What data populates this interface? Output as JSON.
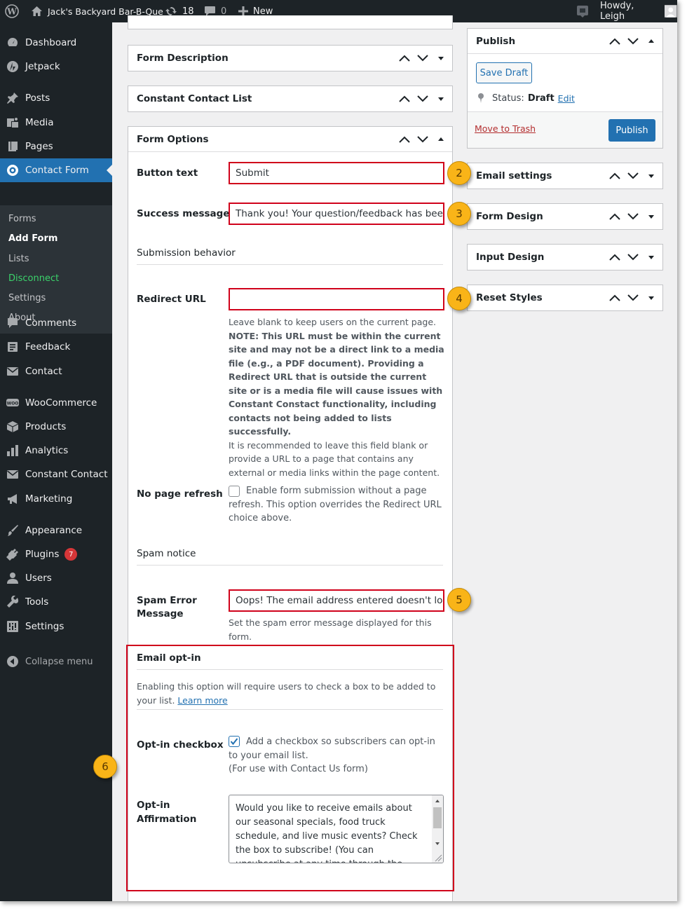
{
  "admin_bar": {
    "site_name": "Jack's Backyard Bar-B-Que",
    "updates_count": "18",
    "comments_count": "0",
    "new_label": "New",
    "howdy": "Howdy, Leigh"
  },
  "sidebar": {
    "items": [
      {
        "label": "Dashboard",
        "icon": "dashboard-icon"
      },
      {
        "label": "Jetpack",
        "icon": "jetpack-icon"
      },
      {
        "label": "Posts",
        "icon": "pin-icon"
      },
      {
        "label": "Media",
        "icon": "media-icon"
      },
      {
        "label": "Pages",
        "icon": "pages-icon"
      },
      {
        "label": "Contact Form",
        "icon": "contact-form-icon"
      },
      {
        "label": "Comments",
        "icon": "comment-icon"
      },
      {
        "label": "Feedback",
        "icon": "feedback-icon"
      },
      {
        "label": "Contact",
        "icon": "envelope-icon"
      },
      {
        "label": "WooCommerce",
        "icon": "woocommerce-icon"
      },
      {
        "label": "Products",
        "icon": "box-icon"
      },
      {
        "label": "Analytics",
        "icon": "bar-chart-icon"
      },
      {
        "label": "Constant Contact",
        "icon": "envelope-icon"
      },
      {
        "label": "Marketing",
        "icon": "megaphone-icon"
      },
      {
        "label": "Appearance",
        "icon": "brush-icon"
      },
      {
        "label": "Plugins",
        "icon": "plug-icon",
        "badge": "7"
      },
      {
        "label": "Users",
        "icon": "user-icon"
      },
      {
        "label": "Tools",
        "icon": "wrench-icon"
      },
      {
        "label": "Settings",
        "icon": "sliders-icon"
      }
    ],
    "submenu": [
      "Forms",
      "Add Form",
      "Lists",
      "Disconnect",
      "Settings",
      "About"
    ],
    "collapse": "Collapse menu"
  },
  "main": {
    "boxes": {
      "form_description": "Form Description",
      "cc_list": "Constant Contact List",
      "form_options": "Form Options"
    },
    "button_text": {
      "label": "Button text",
      "value": "Submit"
    },
    "success_message": {
      "label": "Success message",
      "value": "Thank you! Your question/feedback has been s"
    },
    "submission_behavior": "Submission behavior",
    "redirect_url": {
      "label": "Redirect URL",
      "value": "",
      "help_1": "Leave blank to keep users on the current page.",
      "help_note": "NOTE: This URL must be within the current site and may not be a direct link to a media file (e.g., a PDF document). Providing a Redirect URL that is outside the current site or is a media file will cause issues with Constant Constact functionality, including contacts not being added to lists successfully.",
      "help_2": "It is recommended to leave this field blank or provide a URL to a page that contains any external or media links within the page content."
    },
    "no_refresh": {
      "label": "No page refresh",
      "text": "Enable form submission without a page refresh. This option overrides the Redirect URL choice above."
    },
    "spam_notice": "Spam notice",
    "spam_error": {
      "label_1": "Spam Error",
      "label_2": "Message",
      "value": "Oops! The email address entered doesn't look c",
      "help": "Set the spam error message displayed for this form."
    },
    "email_optin": {
      "title": "Email opt-in",
      "desc": "Enabling this option will require users to check a box to be added to your list.",
      "learn_more": "Learn more",
      "checkbox_label": "Opt-in checkbox",
      "checkbox_text_1": "Add a checkbox so subscribers can opt-in to your email list.",
      "checkbox_text_2": "(For use with Contact Us form)",
      "affirmation_label_1": "Opt-in",
      "affirmation_label_2": "Affirmation",
      "affirmation_text": "Would you like to receive emails about our seasonal specials, food truck schedule, and live music events? Check the box to subscribe! (You can unsubscribe at any time through the \"Unsubscribe\" link in any email)"
    }
  },
  "right": {
    "publish": {
      "title": "Publish",
      "save_draft": "Save Draft",
      "status_label": "Status:",
      "status_value": "Draft",
      "edit": "Edit",
      "trash": "Move to Trash",
      "publish_btn": "Publish"
    },
    "boxes": [
      "Email settings",
      "Form Design",
      "Input Design",
      "Reset Styles"
    ]
  },
  "callouts": [
    "2",
    "3",
    "4",
    "5",
    "6"
  ]
}
